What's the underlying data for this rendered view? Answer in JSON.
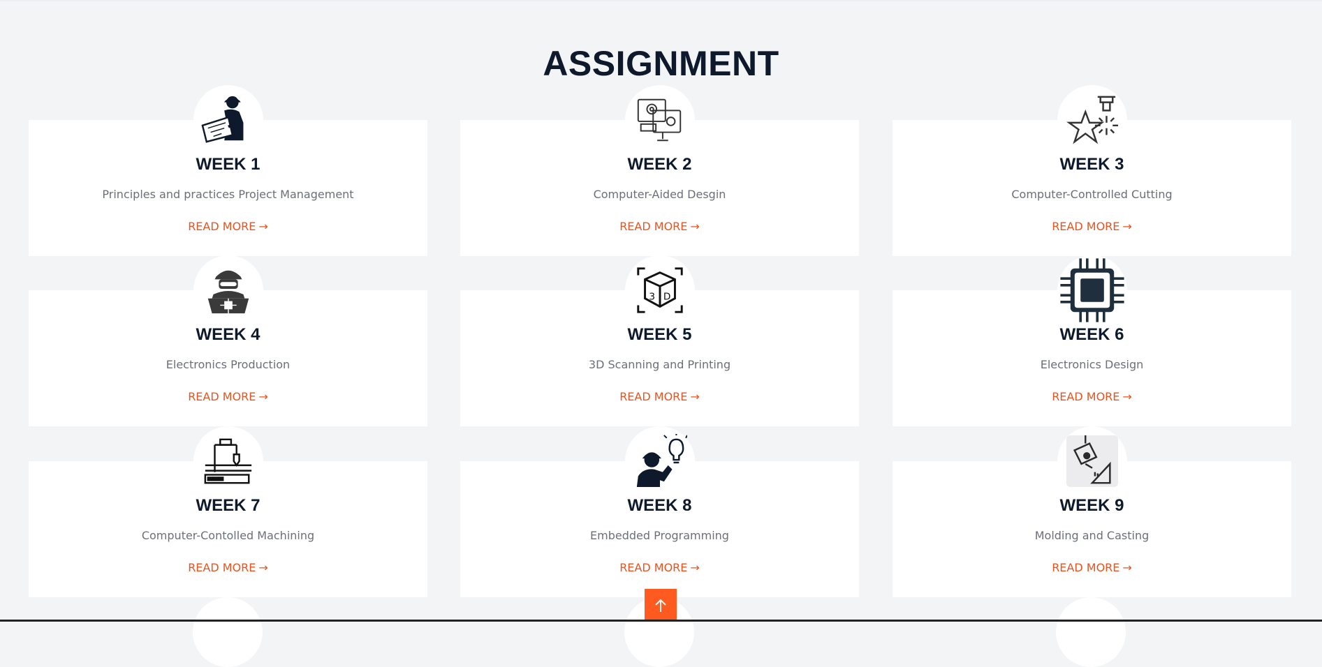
{
  "section": {
    "title": "ASSIGNMENT"
  },
  "read_more_label": "READ MORE",
  "arrow_glyph": "→",
  "accent_color": "#e8531f",
  "cards": [
    {
      "week": "WEEK 1",
      "description": "Principles and practices Project Management",
      "icon": "engineer-blueprint-icon"
    },
    {
      "week": "WEEK 2",
      "description": "Computer-Aided Desgin",
      "icon": "computer-design-icon"
    },
    {
      "week": "WEEK 3",
      "description": "Computer-Controlled Cutting",
      "icon": "laser-cutting-star-icon"
    },
    {
      "week": "WEEK 4",
      "description": "Electronics Production",
      "icon": "engineer-laptop-chip-icon"
    },
    {
      "week": "WEEK 5",
      "description": "3D Scanning and Printing",
      "icon": "3d-scan-cube-icon"
    },
    {
      "week": "WEEK 6",
      "description": "Electronics Design",
      "icon": "microchip-icon"
    },
    {
      "week": "WEEK 7",
      "description": "Computer-Contolled Machining",
      "icon": "cnc-machine-icon"
    },
    {
      "week": "WEEK 8",
      "description": "Embedded Programming",
      "icon": "engineer-lightbulb-icon"
    },
    {
      "week": "WEEK 9",
      "description": "Molding and Casting",
      "icon": "casting-ladle-icon"
    }
  ],
  "back_to_top": {
    "icon": "arrow-up-icon"
  }
}
